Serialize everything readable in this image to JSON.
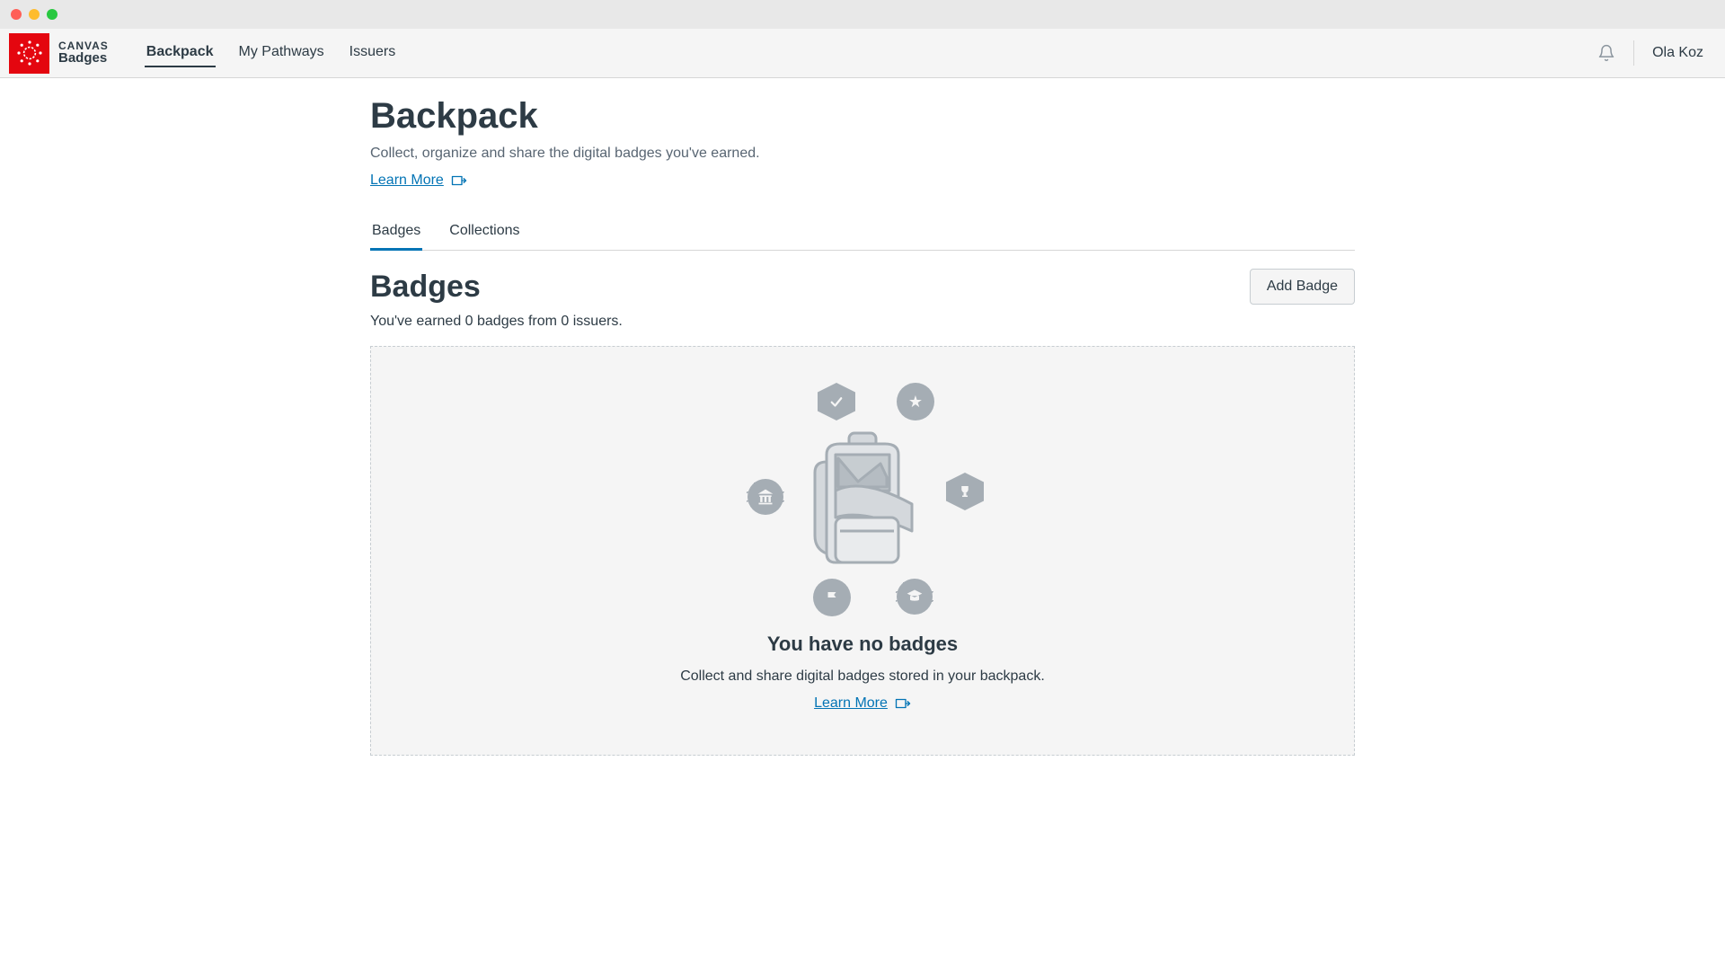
{
  "app": {
    "name_line1": "CANVAS",
    "name_line2": "Badges"
  },
  "nav": {
    "items": [
      {
        "label": "Backpack",
        "active": true
      },
      {
        "label": "My Pathways",
        "active": false
      },
      {
        "label": "Issuers",
        "active": false
      }
    ]
  },
  "user": {
    "display_name": "Ola Koz"
  },
  "page": {
    "title": "Backpack",
    "subtitle": "Collect, organize and share the digital badges you've earned.",
    "learn_more": "Learn More"
  },
  "tabs": [
    {
      "label": "Badges",
      "active": true
    },
    {
      "label": "Collections",
      "active": false
    }
  ],
  "badges_section": {
    "title": "Badges",
    "summary": "You've earned 0 badges from 0 issuers.",
    "add_button": "Add Badge"
  },
  "empty_state": {
    "title": "You have no badges",
    "subtitle": "Collect and share digital badges stored in your backpack.",
    "learn_more": "Learn More"
  }
}
